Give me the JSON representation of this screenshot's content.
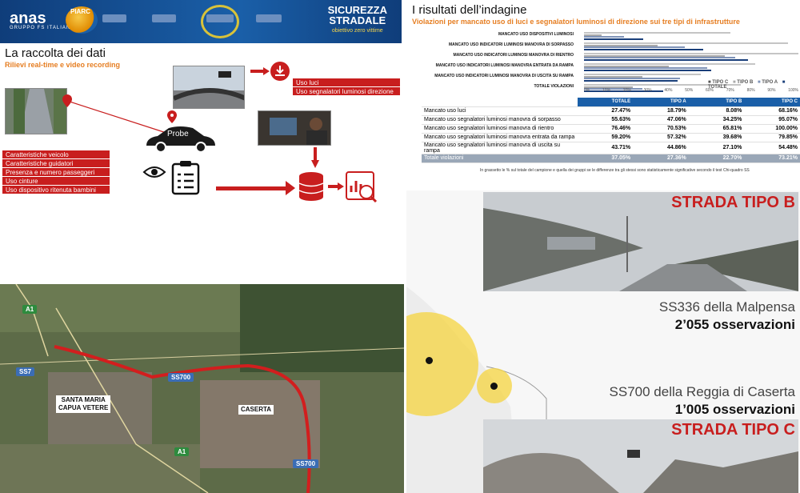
{
  "collection": {
    "logo": "anas",
    "logo_sub": "GRUPPO FS ITALIANE",
    "piarc": "PIARC",
    "sic_title_1": "SICUREZZA",
    "sic_title_2": "STRADALE",
    "sic_tag": "obiettivo zero vittime",
    "title": "La raccolta dei dati",
    "subtitle": "Rilievi real-time e video recording",
    "probe": "Probe",
    "uso_list": [
      "Uso luci",
      "Uso segnalatori luminosi direzione"
    ],
    "data_list": [
      "Caratteristiche veicolo",
      "Caratteristiche guidatori",
      "Presenza e numero passeggeri",
      "Uso cinture",
      "Uso dispositivo ritenuta bambini"
    ]
  },
  "results": {
    "title": "I risultati dell’indagine",
    "subtitle": "Violazioni per mancato uso di luci e segnalatori luminosi di direzione sui tre tipi di infrastrutture",
    "chart_rows": [
      "MANCATO USO DISPOSITIVI LUMINOSI",
      "MANCATO USO INDICATORI LUMINOSI MANOVRA DI SORPASSO",
      "MANCATO USO INDICATORI LUMINOSI MANOVRA DI RIENTRO",
      "MANCATO USO INDICATORI LUMINOSI MANOVRA ENTRATA DA RAMPA",
      "MANCATO USO INDICATORI LUMINOSI MANOVRA DI USCITA SU RAMPA",
      "TOTALE VIOLAZIONI"
    ],
    "legend": [
      "TIPO C",
      "TIPO B",
      "TIPO A",
      "TOTALE"
    ],
    "axis": [
      "0%",
      "10%",
      "20%",
      "30%",
      "40%",
      "50%",
      "60%",
      "70%",
      "80%",
      "90%",
      "100%"
    ],
    "headers": [
      "TOTALE",
      "TIPO A",
      "TIPO B",
      "TIPO C"
    ],
    "rows": [
      {
        "label": "Mancato uso luci",
        "v": [
          "27.47%",
          "18.79%",
          "8.08%",
          "68.16%"
        ]
      },
      {
        "label": "Mancato uso segnalatori luminosi manovra di sorpasso",
        "v": [
          "55.63%",
          "47.06%",
          "34.25%",
          "95.07%"
        ]
      },
      {
        "label": "Mancato uso segnalatori luminosi manovra di rientro",
        "v": [
          "76.46%",
          "70.53%",
          "65.81%",
          "100.00%"
        ]
      },
      {
        "label": "Mancato uso segnalatori luminosi manovra entrata da rampa",
        "v": [
          "59.20%",
          "57.32%",
          "39.68%",
          "79.85%"
        ]
      },
      {
        "label": "Mancato uso segnalatori luminosi manovra di uscita su rampa",
        "v": [
          "43.71%",
          "44.86%",
          "27.10%",
          "54.48%"
        ]
      },
      {
        "label": "Totale violazioni",
        "v": [
          "37.05%",
          "27.36%",
          "22.70%",
          "73.21%"
        ]
      }
    ],
    "note": "In grassetto le % sul totale del campione e quella dei gruppi se le differenze tra gli stessi sono statisticamente significative secondo il test Chi-quadro SS"
  },
  "map": {
    "chips": [
      "A1",
      "SS7",
      "SS700",
      "A1",
      "SS700"
    ],
    "place1_a": "SANTA MARIA",
    "place1_b": "CAPUA VETERE",
    "place2": "CASERTA"
  },
  "roads": {
    "tipo_b": "STRADA TIPO B",
    "road1": "SS336 della Malpensa",
    "obs1": "2’055 osservazioni",
    "road2": "SS700 della Reggia di Caserta",
    "obs2": "1’005 osservazioni",
    "tipo_c": "STRADA TIPO C"
  },
  "colors": {
    "anas_blue": "#1a5fa8",
    "red": "#c81e1e",
    "orange": "#e67e22",
    "yellow": "#f5d44a"
  }
}
